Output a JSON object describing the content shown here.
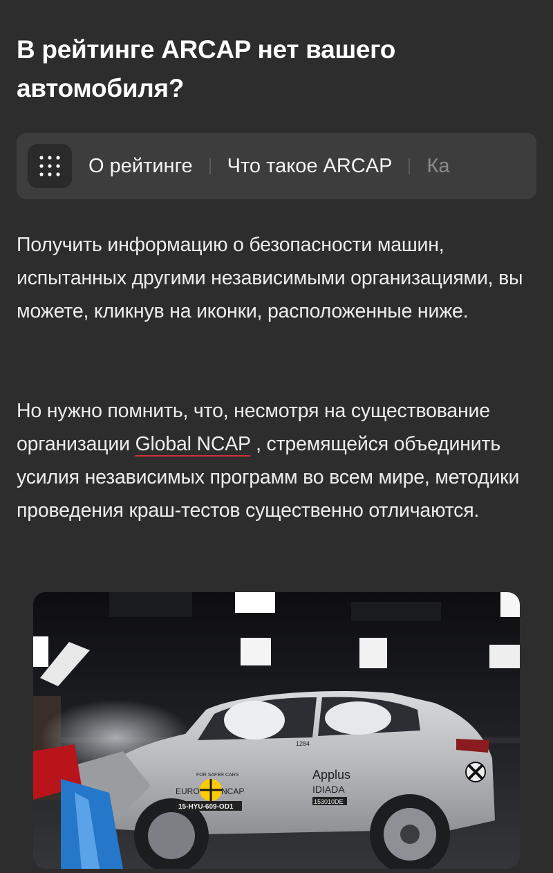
{
  "article": {
    "heading": "В рейтинге ARCAP нет вашего автомобиля?",
    "nav": {
      "menu_icon": "grid-dots-icon",
      "tabs": [
        {
          "label": "О рейтинге"
        },
        {
          "label": "Что такое ARCAP"
        },
        {
          "label": "Ка"
        }
      ]
    },
    "paragraph1": "Получить информацию о безопасности машин, испытанных другими независимыми организациями, вы можете, кликнув на иконки, расположенные ниже.",
    "paragraph2": {
      "before": "Но нужно помнить, что, несмотря на существование организации ",
      "link": "Global NCAP",
      "after": " , стремящейся объединить усилия независимых программ во всем мире, методики проведения краш-тестов существенно отличаются."
    },
    "photo": {
      "euro_ncap_text_left": "EURO",
      "euro_ncap_text_right": "NCAP",
      "euro_ncap_arc": "FOR SAFER CARS",
      "plate_left": "15-HYU-609-OD1",
      "applus": "Applus",
      "idiada": "IDIADA",
      "plate_right": "153010DE",
      "door_number": "1284"
    }
  },
  "colors": {
    "page_bg": "#1b1b1b",
    "card_bg": "#2d2d2d",
    "tabs_bg": "#3d3d3d",
    "link_underline": "#d0303a"
  }
}
